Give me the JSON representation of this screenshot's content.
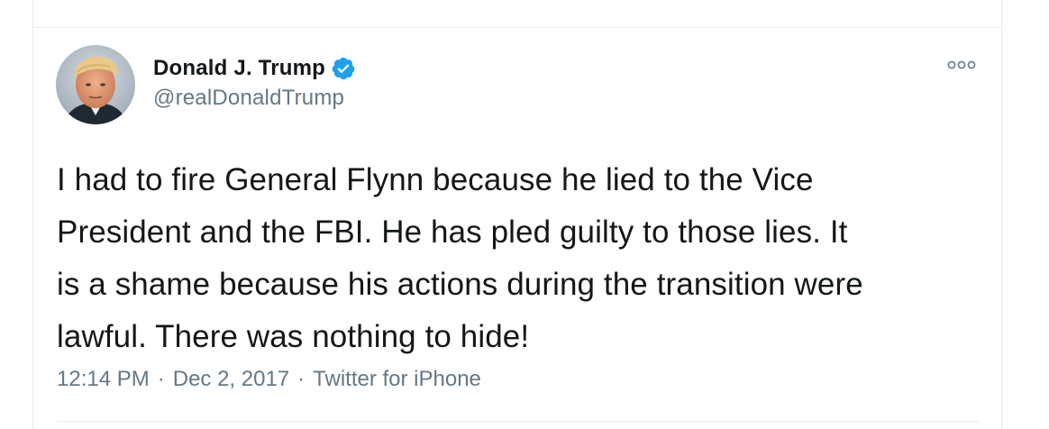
{
  "tweet": {
    "author": {
      "display_name": "Donald J. Trump",
      "handle": "@realDonaldTrump",
      "verified": true,
      "avatar_icon": "profile-photo"
    },
    "text": "I had to fire General Flynn because he lied to the Vice\nPresident and the FBI. He has pled guilty to those lies. It\nis a shame because his actions during the transition were\nlawful. There was nothing to hide!",
    "time": "12:14 PM",
    "date": "Dec 2, 2017",
    "source": "Twitter for iPhone",
    "separator": "·",
    "more_icon": "more-options-icon"
  },
  "colors": {
    "text_primary": "#14171a",
    "text_secondary": "#657786",
    "verified_badge": "#1da1f2",
    "border": "#e6ecf0"
  }
}
